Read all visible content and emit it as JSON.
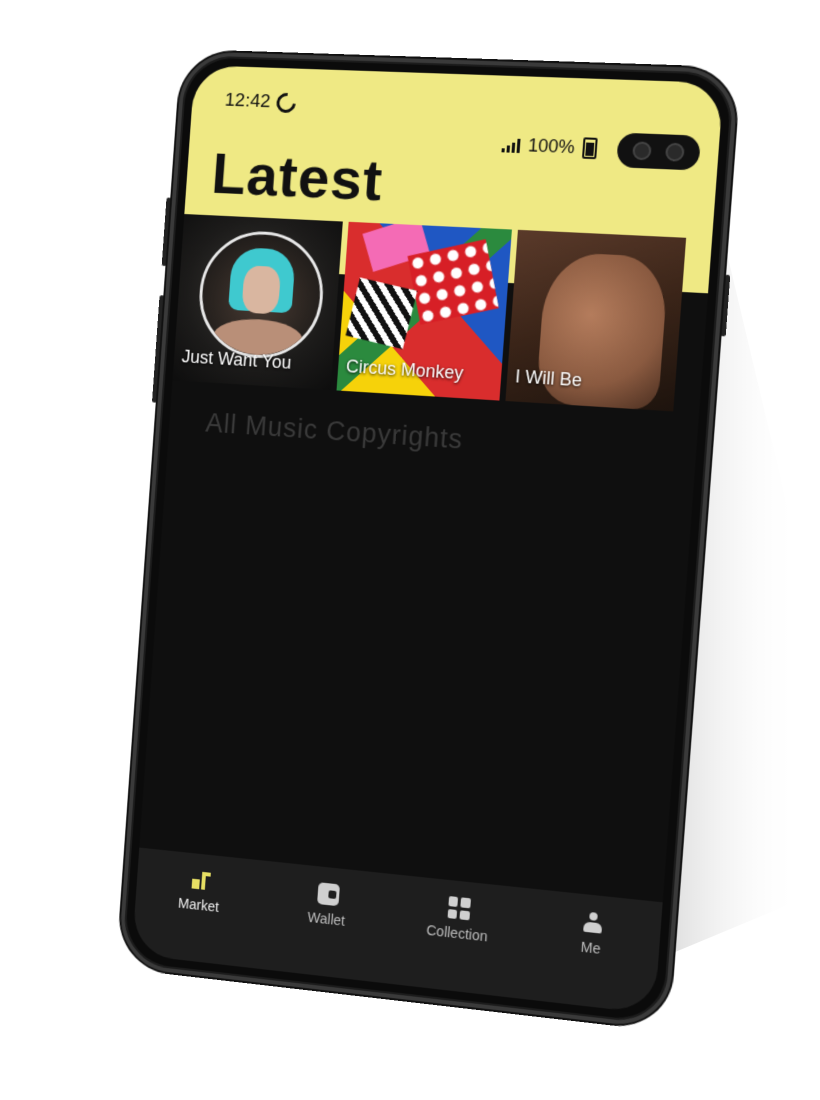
{
  "status_bar": {
    "time": "12:42",
    "battery": "100%",
    "moon_icon": "moon-icon",
    "signal_icon": "signal-icon",
    "battery_icon": "battery-icon"
  },
  "header": {
    "title": "Latest",
    "background": "#efe984"
  },
  "latest": [
    {
      "title": "Just Want You"
    },
    {
      "title": "Circus Monkey"
    },
    {
      "title": "I Will Be"
    }
  ],
  "main": {
    "subtitle": "All Music Copyrights"
  },
  "tabbar": {
    "active": "Market",
    "items": [
      {
        "label": "Market",
        "icon": "market-icon"
      },
      {
        "label": "Wallet",
        "icon": "wallet-icon"
      },
      {
        "label": "Collection",
        "icon": "collection-icon"
      },
      {
        "label": "Me",
        "icon": "person-icon"
      }
    ]
  },
  "colors": {
    "accent": "#e7df63",
    "screen_bg": "#0f0f0f",
    "tabbar_bg": "#1e1e1e"
  }
}
